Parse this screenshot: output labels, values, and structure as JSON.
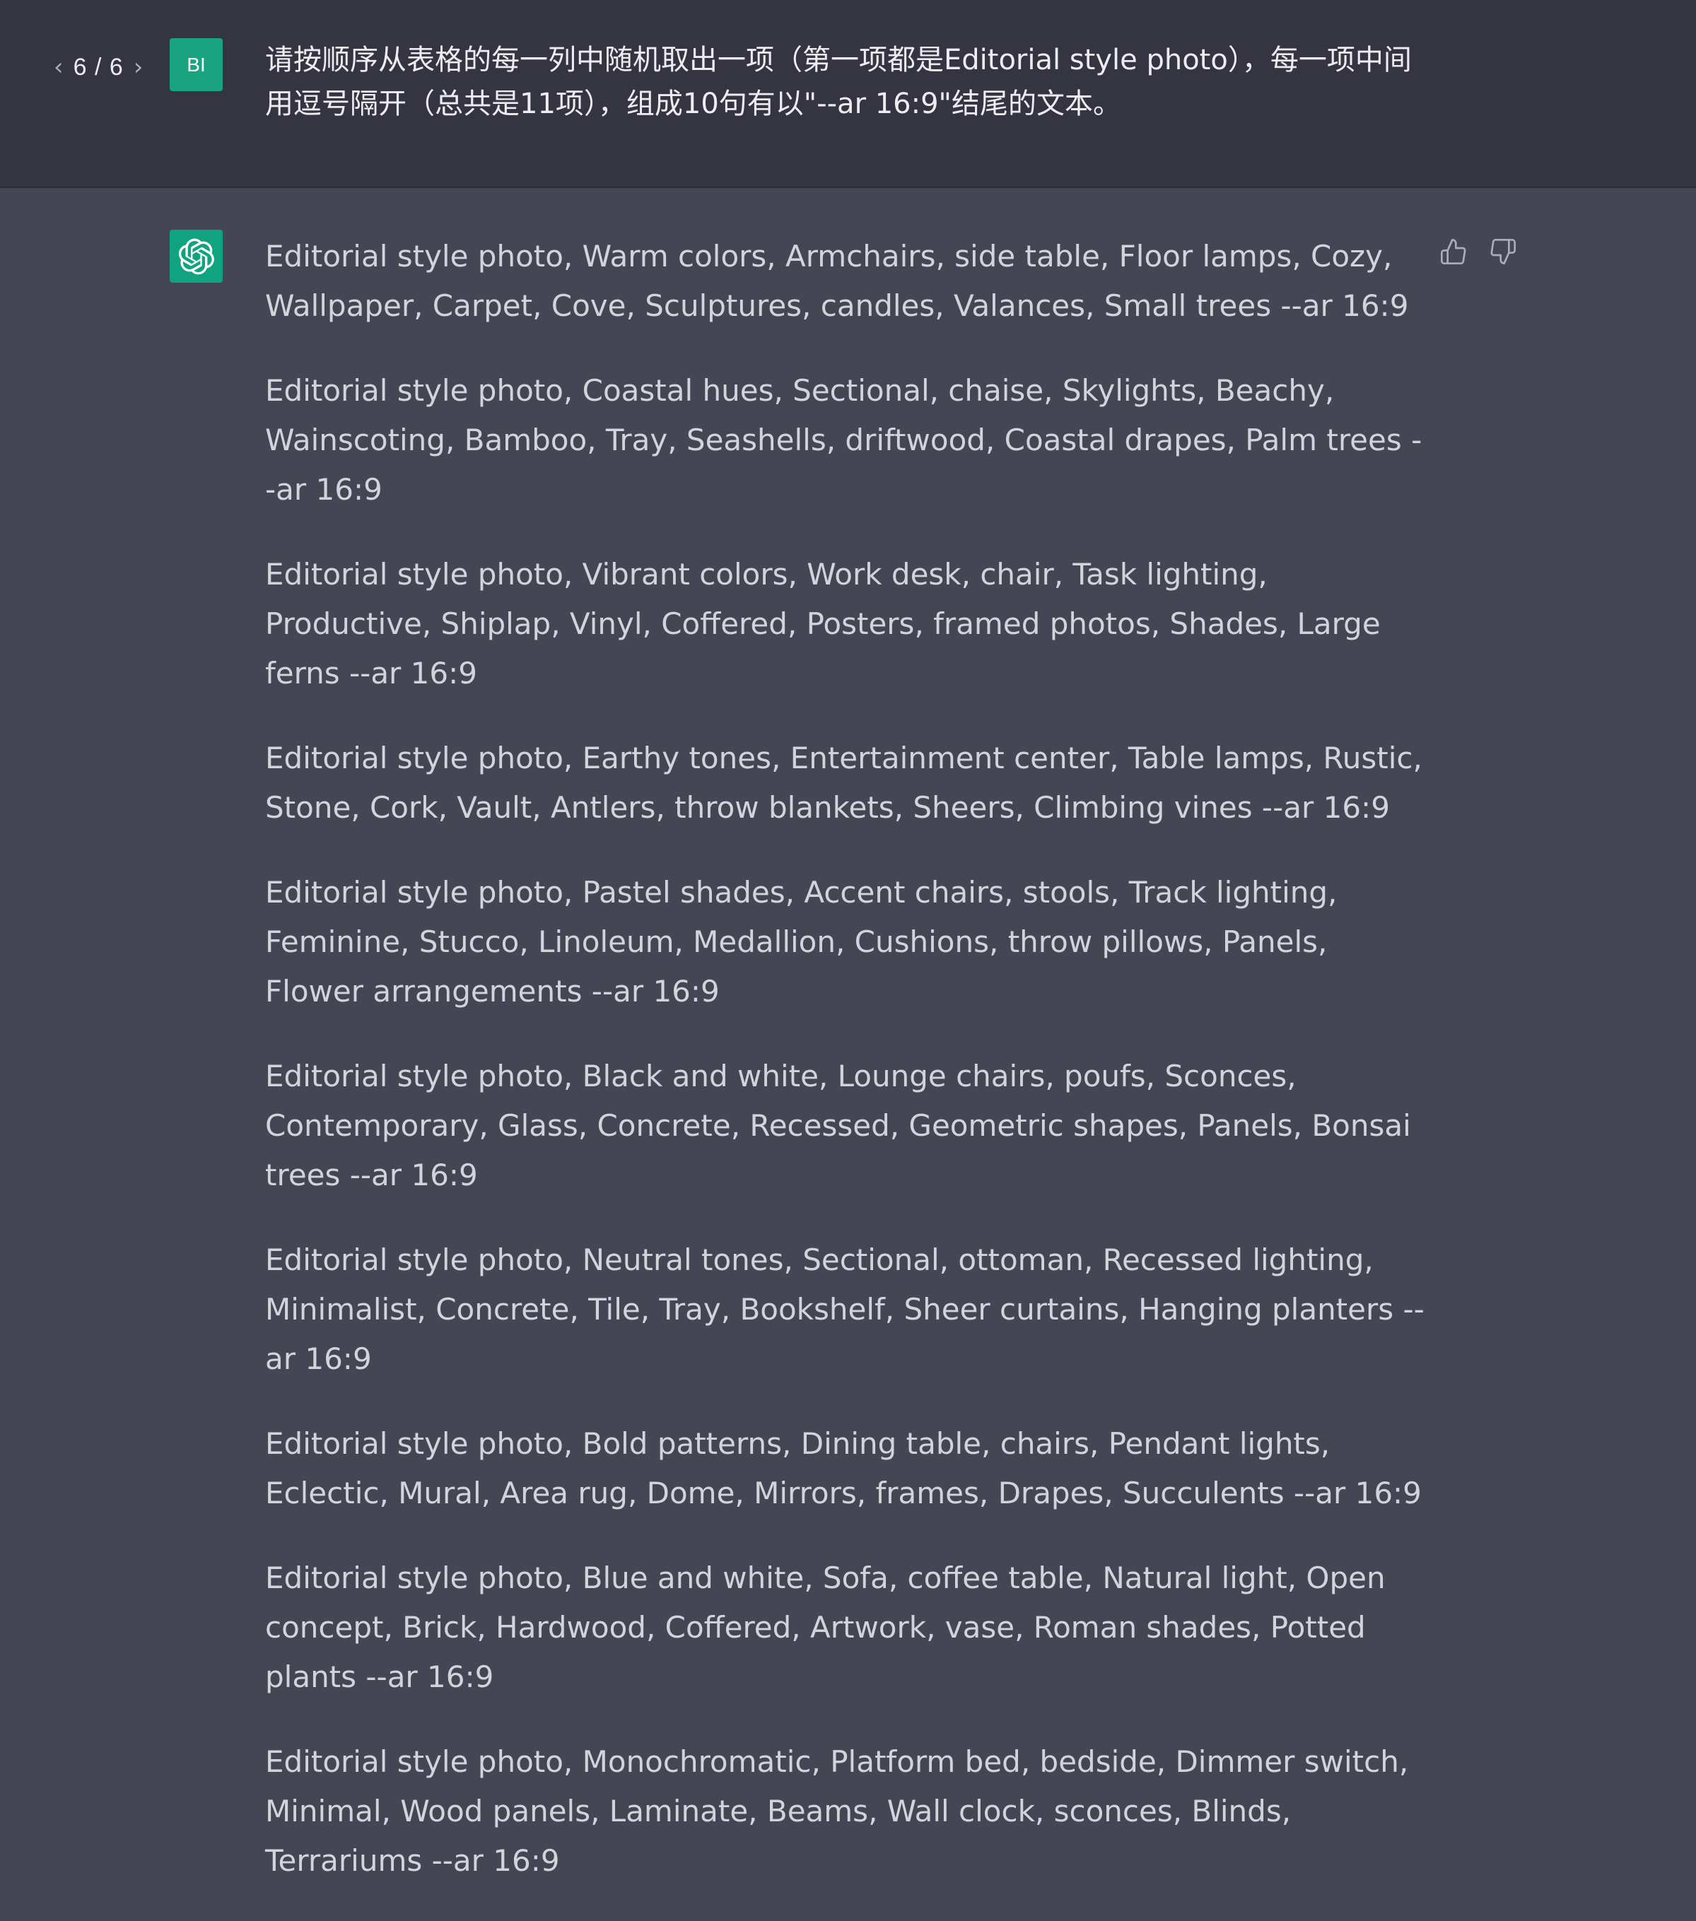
{
  "pager": {
    "prev_icon": "chevron-left-icon",
    "count": "6 / 6",
    "next_icon": "chevron-right-icon"
  },
  "user": {
    "avatar_initials": "BI",
    "avatar_color": "#19a37f",
    "message": "请按顺序从表格的每一列中随机取出一项（第一项都是Editorial style photo），每一项中间用逗号隔开（总共是11项），组成10句有以\"--ar 16:9\"结尾的文本。"
  },
  "assistant": {
    "avatar_icon": "openai-logo-icon",
    "avatar_color": "#10a37f",
    "paragraphs": [
      "Editorial style photo, Warm colors, Armchairs, side table, Floor lamps, Cozy, Wallpaper, Carpet, Cove, Sculptures, candles, Valances, Small trees --ar 16:9",
      "Editorial style photo, Coastal hues, Sectional, chaise, Skylights, Beachy, Wainscoting, Bamboo, Tray, Seashells, driftwood, Coastal drapes, Palm trees --ar 16:9",
      "Editorial style photo, Vibrant colors, Work desk, chair, Task lighting, Productive, Shiplap, Vinyl, Coffered, Posters, framed photos, Shades, Large ferns --ar 16:9",
      "Editorial style photo, Earthy tones, Entertainment center, Table lamps, Rustic, Stone, Cork, Vault, Antlers, throw blankets, Sheers, Climbing vines --ar 16:9",
      "Editorial style photo, Pastel shades, Accent chairs, stools, Track lighting, Feminine, Stucco, Linoleum, Medallion, Cushions, throw pillows, Panels, Flower arrangements --ar 16:9",
      "Editorial style photo, Black and white, Lounge chairs, poufs, Sconces, Contemporary, Glass, Concrete, Recessed, Geometric shapes, Panels, Bonsai trees --ar 16:9",
      "Editorial style photo, Neutral tones, Sectional, ottoman, Recessed lighting, Minimalist, Concrete, Tile, Tray, Bookshelf, Sheer curtains, Hanging planters --ar 16:9",
      "Editorial style photo, Bold patterns, Dining table, chairs, Pendant lights, Eclectic, Mural, Area rug, Dome, Mirrors, frames, Drapes, Succulents --ar 16:9",
      "Editorial style photo, Blue and white, Sofa, coffee table, Natural light, Open concept, Brick, Hardwood, Coffered, Artwork, vase, Roman shades, Potted plants --ar 16:9",
      "Editorial style photo, Monochromatic, Platform bed, bedside, Dimmer switch, Minimal, Wood panels, Laminate, Beams, Wall clock, sconces, Blinds, Terrariums --ar 16:9"
    ]
  },
  "feedback": {
    "thumbs_up_icon": "thumbs-up-icon",
    "thumbs_down_icon": "thumbs-down-icon"
  },
  "colors": {
    "user_row_bg": "#343541",
    "assistant_row_bg": "#444654",
    "text": "#d1d5db"
  }
}
